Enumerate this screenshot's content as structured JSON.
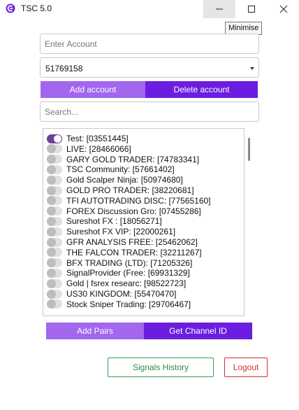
{
  "window": {
    "title": "TSC 5.0",
    "tooltip": "Minimise"
  },
  "account_input": {
    "placeholder": "Enter Account"
  },
  "account_select": {
    "value": "51769158"
  },
  "buttons": {
    "add_account": "Add account",
    "delete_account": "Delete account",
    "add_pairs": "Add Pairs",
    "get_channel_id": "Get Channel ID",
    "signals_history": "Signals History",
    "logout": "Logout"
  },
  "search": {
    "placeholder": "Search..."
  },
  "channels": [
    {
      "label": "Test: [03551445]",
      "enabled": true
    },
    {
      "label": "LIVE: [28466066]",
      "enabled": false
    },
    {
      "label": "GARY GOLD TRADER: [74783341]",
      "enabled": false
    },
    {
      "label": "TSC Community: [57661402]",
      "enabled": false
    },
    {
      "label": "Gold Scalper Ninja: [50974680]",
      "enabled": false
    },
    {
      "label": "GOLD PRO TRADER: [38220681]",
      "enabled": false
    },
    {
      "label": "TFI AUTOTRADING DISC: [77565160]",
      "enabled": false
    },
    {
      "label": "FOREX Discussion Gro: [07455286]",
      "enabled": false
    },
    {
      "label": "Sureshot FX : [18056271]",
      "enabled": false
    },
    {
      "label": "Sureshot FX VIP: [22000261]",
      "enabled": false
    },
    {
      "label": "GFR ANALYSIS FREE: [25462062]",
      "enabled": false
    },
    {
      "label": "THE FALCON TRADER: [32211267]",
      "enabled": false
    },
    {
      "label": "BFX TRADING (LTD): [71205326]",
      "enabled": false
    },
    {
      "label": "SignalProvider (Free: [69931329]",
      "enabled": false
    },
    {
      "label": "Gold | fsrex researc: [98522723]",
      "enabled": false
    },
    {
      "label": "US30 KINGDOM: [55470470]",
      "enabled": false
    },
    {
      "label": "Stock Sniper Trading: [29706467]",
      "enabled": false
    }
  ],
  "colors": {
    "accent_light": "#a266ef",
    "accent_dark": "#6b1ee0",
    "signals_green": "#2e8b3f",
    "logout_red": "#d0312d"
  }
}
